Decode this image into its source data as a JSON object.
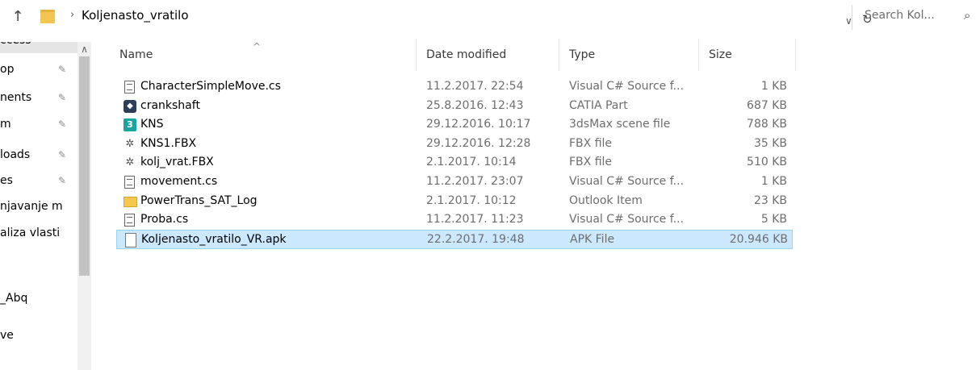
{
  "address": {
    "up_icon": "↑",
    "separator": "›",
    "breadcrumb": "Koljenasto_vratilo",
    "dropdown_icon": "∨",
    "refresh_icon": "↻"
  },
  "search": {
    "placeholder": "Search Kol...",
    "icon": "⌕"
  },
  "nav": {
    "scroll_up": "∧",
    "items": [
      {
        "label": "ccess",
        "pinned": false
      },
      {
        "label": "op",
        "pinned": true
      },
      {
        "label": "nents",
        "pinned": true
      },
      {
        "label": "m",
        "pinned": true
      },
      {
        "label": "loads",
        "pinned": true
      },
      {
        "label": "es",
        "pinned": true
      },
      {
        "label": "njavanje m",
        "pinned": false
      },
      {
        "label": "aliza vlasti",
        "pinned": false
      },
      {
        "label": "_Abq",
        "pinned": false
      },
      {
        "label": "ve",
        "pinned": false
      }
    ],
    "pin_icon": "✎"
  },
  "columns": {
    "name": "Name",
    "date": "Date modified",
    "type": "Type",
    "size": "Size",
    "sort_icon": "^"
  },
  "files": [
    {
      "name": "CharacterSimpleMove.cs",
      "date": "11.2.2017. 22:54",
      "type": "Visual C# Source f...",
      "size": "1 KB",
      "icon": "text-file-icon"
    },
    {
      "name": "crankshaft",
      "date": "25.8.2016. 12:43",
      "type": "CATIA Part",
      "size": "687 KB",
      "icon": "catia-icon"
    },
    {
      "name": "KNS",
      "date": "29.12.2016. 10:17",
      "type": "3dsMax scene file",
      "size": "788 KB",
      "icon": "3dsmax-icon"
    },
    {
      "name": "KNS1.FBX",
      "date": "29.12.2016. 12:28",
      "type": "FBX file",
      "size": "35 KB",
      "icon": "fbx-icon"
    },
    {
      "name": "kolj_vrat.FBX",
      "date": "2.1.2017. 10:14",
      "type": "FBX file",
      "size": "510 KB",
      "icon": "fbx-icon"
    },
    {
      "name": "movement.cs",
      "date": "11.2.2017. 23:07",
      "type": "Visual C# Source f...",
      "size": "1 KB",
      "icon": "text-file-icon"
    },
    {
      "name": "PowerTrans_SAT_Log",
      "date": "2.1.2017. 10:12",
      "type": "Outlook Item",
      "size": "23 KB",
      "icon": "mail-icon"
    },
    {
      "name": "Proba.cs",
      "date": "11.2.2017. 11:23",
      "type": "Visual C# Source f...",
      "size": "5 KB",
      "icon": "text-file-icon"
    },
    {
      "name": "Koljenasto_vratilo_VR.apk",
      "date": "22.2.2017. 19:48",
      "type": "APK File",
      "size": "20.946 KB",
      "icon": "blank-file-icon",
      "selected": true
    }
  ]
}
